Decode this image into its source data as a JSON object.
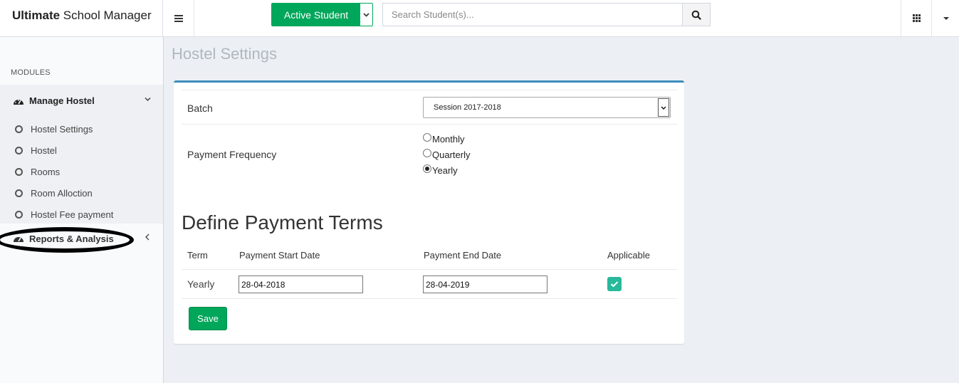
{
  "header": {
    "brand_bold": "Ultimate",
    "brand_rest": " School Manager",
    "active_student_label": "Active Student",
    "search_placeholder": "Search Student(s)..."
  },
  "sidebar": {
    "modules_label": "MODULES",
    "group_label": "Manage Hostel",
    "items": [
      {
        "label": "Hostel Settings"
      },
      {
        "label": "Hostel"
      },
      {
        "label": "Rooms"
      },
      {
        "label": "Room Alloction"
      },
      {
        "label": "Hostel Fee payment"
      }
    ],
    "reports_label": "Reports & Analysis"
  },
  "main": {
    "page_title": "Hostel Settings",
    "batch_label": "Batch",
    "batch_value": "Session 2017-2018",
    "payment_frequency_label": "Payment Frequency",
    "frequency_options": [
      {
        "label": "Monthly",
        "checked": false
      },
      {
        "label": "Quarterly",
        "checked": false
      },
      {
        "label": "Yearly",
        "checked": true
      }
    ],
    "terms_title": "Define Payment Terms",
    "table": {
      "headers": [
        "Term",
        "Payment Start Date",
        "Payment End Date",
        "Applicable"
      ],
      "rows": [
        {
          "term": "Yearly",
          "start": "28-04-2018",
          "end": "28-04-2019",
          "applicable": true
        }
      ]
    },
    "save_label": "Save"
  },
  "colors": {
    "accent_green": "#00a65a",
    "box_top_border": "#3c8dbc",
    "checkbox_teal": "#26b99a",
    "annotation_circle": "#000000"
  }
}
